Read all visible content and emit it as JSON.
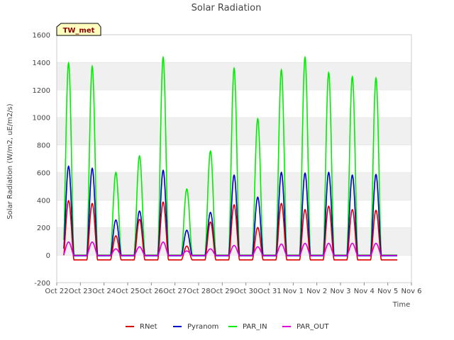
{
  "chart_data": {
    "type": "line",
    "title": "Solar Radiation",
    "xlabel": "Time",
    "ylabel": "Solar Radiation (W/m2, uE/m2/s)",
    "annotation": "TW_met",
    "ylim": [
      -200,
      1600
    ],
    "xlim": [
      0,
      15
    ],
    "yticks": [
      -200,
      0,
      200,
      400,
      600,
      800,
      1000,
      1200,
      1400,
      1600
    ],
    "xtick_labels": [
      "Oct 22",
      "Oct 23",
      "Oct 24",
      "Oct 25",
      "Oct 26",
      "Oct 27",
      "Oct 28",
      "Oct 29",
      "Oct 30",
      "Oct 31",
      "Nov 1",
      "Nov 2",
      "Nov 3",
      "Nov 4",
      "Nov 5",
      "Nov 6"
    ],
    "grid": "horizontal bands",
    "legend_position": "bottom",
    "day_range": [
      0.3,
      14.4
    ],
    "series": [
      {
        "name": "RNet",
        "color": "#dd0000",
        "night_level": -35,
        "daily_peaks": [
          395,
          375,
          140,
          260,
          385,
          65,
          240,
          365,
          200,
          375,
          330,
          355,
          330,
          325
        ]
      },
      {
        "name": "Pyranom",
        "color": "#0000cc",
        "night_level": -5,
        "daily_peaks": [
          645,
          630,
          255,
          320,
          615,
          180,
          310,
          580,
          420,
          600,
          595,
          600,
          580,
          585
        ]
      },
      {
        "name": "PAR_IN",
        "color": "#00ee00",
        "night_level": 0,
        "daily_peaks": [
          1395,
          1370,
          600,
          720,
          1435,
          480,
          755,
          1355,
          990,
          1345,
          1435,
          1325,
          1295,
          1285
        ]
      },
      {
        "name": "PAR_OUT",
        "color": "#dd00dd",
        "night_level": -2,
        "daily_peaks": [
          95,
          95,
          45,
          60,
          95,
          30,
          45,
          70,
          60,
          80,
          85,
          85,
          85,
          85
        ]
      }
    ]
  }
}
